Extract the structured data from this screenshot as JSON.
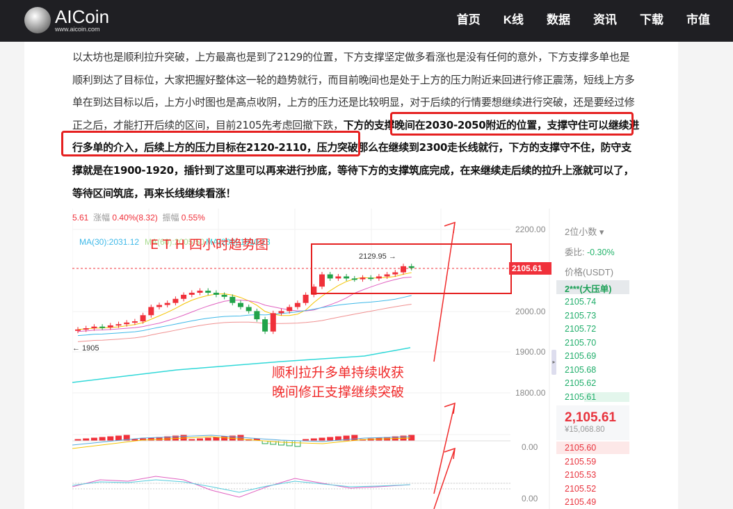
{
  "header": {
    "brand": "AICoin",
    "url": "www.aicoin.com",
    "nav": [
      "首页",
      "K线",
      "数据",
      "资讯",
      "下载",
      "市值"
    ]
  },
  "article": {
    "p1": "以太坊也是顺利拉升突破，上方最高也是到了2129的位置，下方支撑坚定做多看涨也是没有任何的意外，下方支撑多单也是顺利到达了目标位，大家把握好整体这一轮的趋势就行，而目前晚间也是处于上方的压力附近来回进行修正震荡，短线上方多单在到达目标以后，上方小时图也是高点收阴，上方的压力还是比较明显，对于后续的行情要想继续进行突破，还是要经过修正之后，才能打开后续的区间，",
    "p2": "目前2105先考虑回撤下跌，",
    "p3": "下方的支撑晚间在2030-2050附近的位置，支撑守住可以继续进行多单的介入，后续上方的压力目标在2120-2110，压力突破那么在继续到2300走长线就行，下方的支撑守不住，防守支撑就是在1900-1920，插针到了这里可以再来进行抄底，等待下方的支撑筑底完成，在来继续走后续的拉升上涨就可以了，等待区间筑底，再来长线继续看涨！"
  },
  "chart": {
    "stats": {
      "price_tail": "5.61",
      "change_label": "涨幅",
      "change": "0.40%(8.32)",
      "amp_label": "振幅",
      "amp": "0.55%"
    },
    "ma": {
      "ma30": "MA(30):2031.12",
      "ma60": "MA(60):2005.50",
      "ma200": "MA(200):1910.13"
    },
    "title": "E T H 四小时趋势图",
    "high_label": "2129.95 →",
    "low_label": "← 1905",
    "annotation": [
      "顺利拉升多单持续收获",
      "晚间修正支撑继续突破"
    ],
    "axis": [
      "2200.00",
      "2000.00",
      "1900.00",
      "1800.00",
      "0.00",
      "0.00"
    ],
    "current_price": "2105.61",
    "colors": {
      "up": "#f0303a",
      "down": "#22a34a",
      "accent": "#e52020"
    }
  },
  "chart_data": {
    "type": "candlestick",
    "ylim": [
      1800,
      2200
    ],
    "closes": [
      1955,
      1958,
      1962,
      1960,
      1965,
      1968,
      1972,
      1975,
      1990,
      2010,
      2015,
      2020,
      2030,
      2040,
      2045,
      2050,
      2045,
      2040,
      2035,
      2020,
      2010,
      2000,
      1980,
      1950,
      1995,
      2000,
      2010,
      2020,
      2040,
      2060,
      2090,
      2080,
      2085,
      2080,
      2078,
      2082,
      2080,
      2085,
      2090,
      2095,
      2110,
      2105.61
    ]
  },
  "orderbook": {
    "decimals": "2位小数 ▾",
    "ratio_label": "委比:",
    "ratio": "-0.30%",
    "price_header": "价格(USDT)",
    "big_order": "2***(大压单)",
    "asks": [
      "2105.74",
      "2105.73",
      "2105.72",
      "2105.70",
      "2105.69",
      "2105.68",
      "2105.62",
      "2105.61"
    ],
    "last": "2,105.61",
    "cny": "¥15,068.80",
    "bids": [
      "2105.60",
      "2105.59",
      "2105.53",
      "2105.52",
      "2105.49"
    ]
  }
}
